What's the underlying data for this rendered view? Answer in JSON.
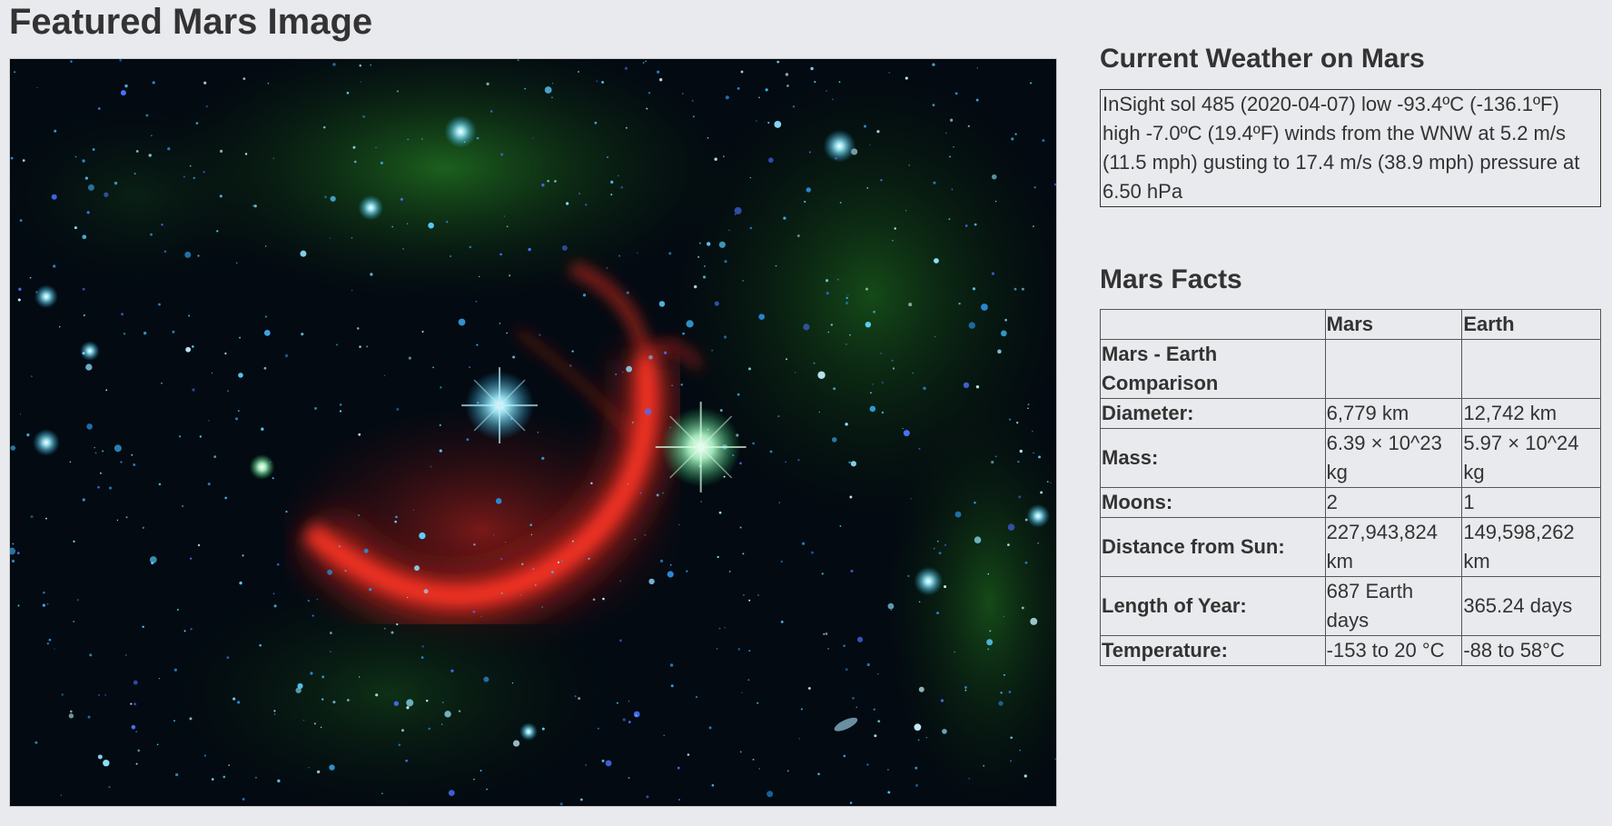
{
  "page_title": "Featured Mars Image",
  "featured_image": {
    "icon": "nebula-image"
  },
  "weather": {
    "title": "Current Weather on Mars",
    "text": "InSight sol 485 (2020-04-07) low -93.4ºC (-136.1ºF) high -7.0ºC (19.4ºF) winds from the WNW at 5.2 m/s (11.5 mph) gusting to 17.4 m/s (38.9 mph) pressure at 6.50 hPa"
  },
  "facts": {
    "title": "Mars Facts",
    "headers": [
      "",
      "Mars",
      "Earth"
    ],
    "rows": [
      {
        "label": "Mars - Earth Comparison",
        "mars": "",
        "earth": ""
      },
      {
        "label": "Diameter:",
        "mars": "6,779 km",
        "earth": "12,742 km"
      },
      {
        "label": "Mass:",
        "mars": "6.39 × 10^23 kg",
        "earth": "5.97 × 10^24 kg"
      },
      {
        "label": "Moons:",
        "mars": "2",
        "earth": "1"
      },
      {
        "label": "Distance from Sun:",
        "mars": "227,943,824 km",
        "earth": "149,598,262 km"
      },
      {
        "label": "Length of Year:",
        "mars": "687 Earth days",
        "earth": "365.24 days"
      },
      {
        "label": "Temperature:",
        "mars": "-153 to 20 °C",
        "earth": "-88 to 58°C"
      }
    ]
  }
}
